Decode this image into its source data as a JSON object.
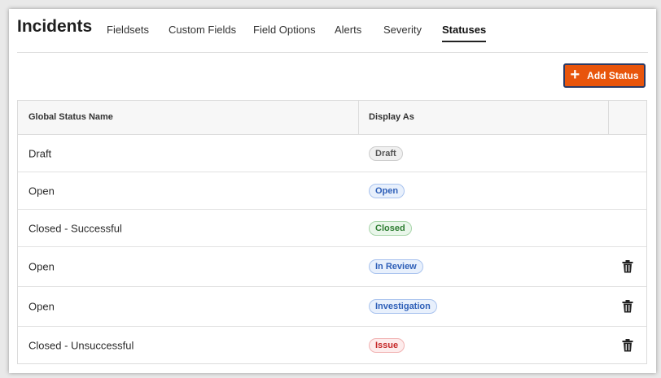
{
  "page": {
    "title": "Incidents"
  },
  "tabs": [
    {
      "label": "Fieldsets",
      "active": false
    },
    {
      "label": "Custom Fields",
      "active": false
    },
    {
      "label": "Field Options",
      "active": false
    },
    {
      "label": "Alerts",
      "active": false
    },
    {
      "label": "Severity",
      "active": false
    },
    {
      "label": "Statuses",
      "active": true
    }
  ],
  "actions": {
    "add_status_label": "Add Status",
    "add_icon": "plus-icon"
  },
  "table": {
    "columns": [
      "Global Status Name",
      "Display As",
      ""
    ],
    "rows": [
      {
        "name": "Draft",
        "badge": "Draft",
        "badge_color": "#555555",
        "badge_bg": "#f0f0f0",
        "badge_border": "#cccccc",
        "deletable": false
      },
      {
        "name": "Open",
        "badge": "Open",
        "badge_color": "#2e5fb8",
        "badge_bg": "#e8f0fc",
        "badge_border": "#a9c3ee",
        "deletable": false
      },
      {
        "name": "Closed - Successful",
        "badge": "Closed",
        "badge_color": "#2e7d32",
        "badge_bg": "#e9f6ea",
        "badge_border": "#a8d5aa",
        "deletable": false
      },
      {
        "name": "Open",
        "badge": "In Review",
        "badge_color": "#2e5fb8",
        "badge_bg": "#e8f0fc",
        "badge_border": "#a9c3ee",
        "deletable": true
      },
      {
        "name": "Open",
        "badge": "Investigation",
        "badge_color": "#2e5fb8",
        "badge_bg": "#e8f0fc",
        "badge_border": "#a9c3ee",
        "deletable": true
      },
      {
        "name": "Closed - Unsuccessful",
        "badge": "Issue",
        "badge_color": "#c62828",
        "badge_bg": "#fdecec",
        "badge_border": "#f1b3b3",
        "deletable": true
      }
    ]
  },
  "colors": {
    "accent": "#e8550c"
  }
}
